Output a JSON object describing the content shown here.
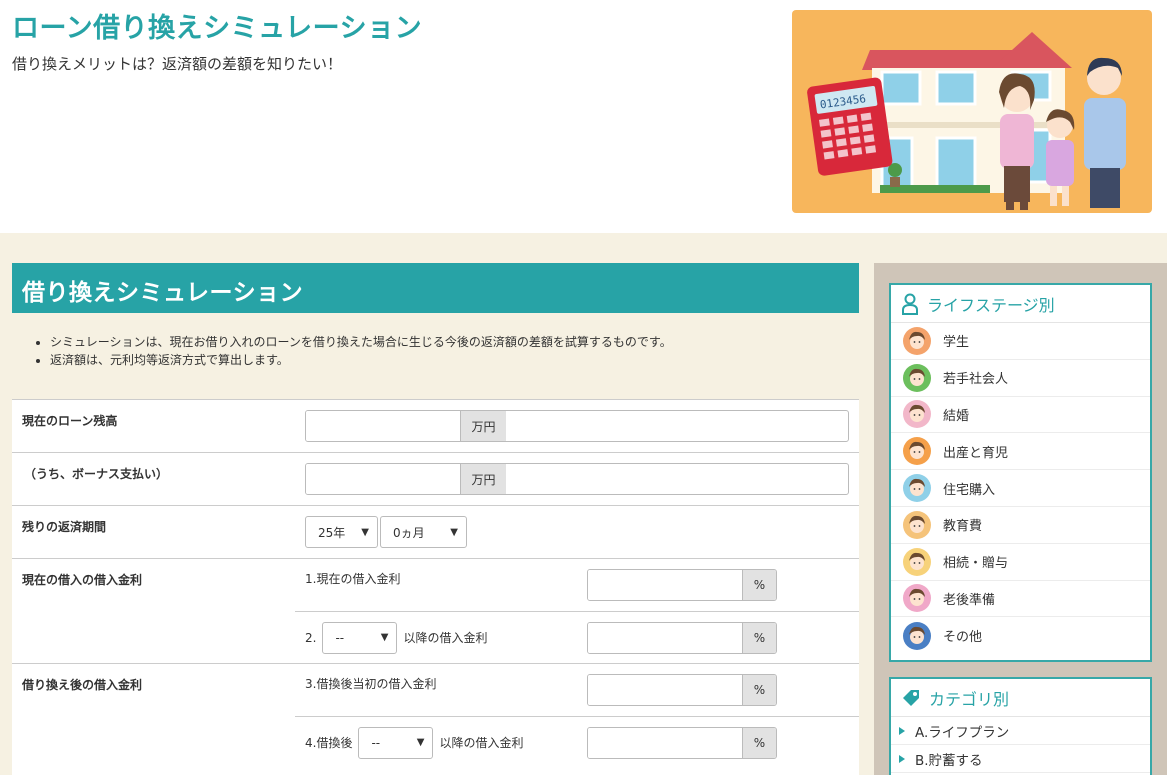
{
  "header": {
    "title": "ローン借り換えシミュレーション",
    "subtitle": "借り換えメリットは？返済額の差額を知りたい！",
    "calculator_display": "0123456"
  },
  "section": {
    "title": "借り換えシミュレーション",
    "notes": [
      "シミュレーションは、現在お借り入れのローンを借り換えた場合に生じる今後の返済額の差額を試算するものです。",
      "返済額は、元利均等返済方式で算出します。"
    ]
  },
  "form": {
    "balance": {
      "label": "現在のローン残高",
      "unit": "万円",
      "value": ""
    },
    "bonus": {
      "label": "（うち、ボーナス支払い）",
      "unit": "万円",
      "value": ""
    },
    "remaining": {
      "label": "残りの返済期間",
      "year_value": "25年",
      "month_value": "0ヵ月"
    },
    "current_rate": {
      "label": "現在の借入の借入金利",
      "sub1_label": "1.現在の借入金利",
      "sub2_prefix": "2.",
      "sub2_select": "--",
      "sub2_suffix": "以降の借入金利",
      "unit": "%"
    },
    "new_rate": {
      "label": "借り換え後の借入金利",
      "sub3_label": "3.借換後当初の借入金利",
      "sub4_prefix": "4.借換後",
      "sub4_select": "--",
      "sub4_suffix": "以降の借入金利",
      "unit": "%"
    }
  },
  "sidebar": {
    "life_stage": {
      "title": "ライフステージ別",
      "items": [
        {
          "label": "学生",
          "icon": "student-icon",
          "color": "#f4a36b"
        },
        {
          "label": "若手社会人",
          "icon": "young-worker-icon",
          "color": "#6cbf5d"
        },
        {
          "label": "結婚",
          "icon": "marriage-icon",
          "color": "#f2b7c9"
        },
        {
          "label": "出産と育児",
          "icon": "childbirth-icon",
          "color": "#f5a04a"
        },
        {
          "label": "住宅購入",
          "icon": "house-icon",
          "color": "#8fd0e8"
        },
        {
          "label": "教育費",
          "icon": "education-icon",
          "color": "#f5c37a"
        },
        {
          "label": "相続・贈与",
          "icon": "inheritance-icon",
          "color": "#f7d27a"
        },
        {
          "label": "老後準備",
          "icon": "retirement-icon",
          "color": "#f0a8c8"
        },
        {
          "label": "その他",
          "icon": "other-icon",
          "color": "#4a7fc4"
        }
      ]
    },
    "category": {
      "title": "カテゴリ別",
      "items": [
        {
          "label": "A.ライフプラン"
        },
        {
          "label": "B.貯蓄する"
        }
      ]
    }
  },
  "colors": {
    "accent": "#27a3a6",
    "page_bg": "#f6f1e2",
    "sidebar_bg": "#cfc5b8",
    "hero_bg": "#f7b65c"
  }
}
